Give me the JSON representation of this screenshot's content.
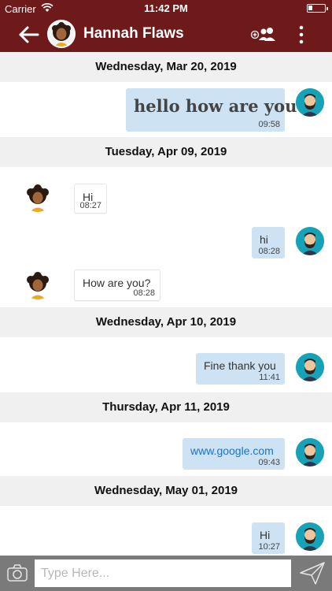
{
  "status_bar": {
    "carrier": "Carrier",
    "time": "11:42 PM",
    "icons": [
      "wifi-icon",
      "battery-icon"
    ]
  },
  "header": {
    "title": "Hannah Flaws",
    "icons": [
      "back-arrow-icon",
      "contact-avatar",
      "add-group-icon",
      "more-vertical-icon"
    ]
  },
  "messages": {
    "date_1": "Wednesday, Mar 20, 2019",
    "date_2": "Tuesday, Apr 09, 2019",
    "date_3": "Wednesday, Apr 10, 2019",
    "date_4": "Thursday, Apr 11, 2019",
    "date_5": "Wednesday, May 01, 2019",
    "m1": {
      "text": "hello how are you",
      "time": "09:58",
      "sender": "me"
    },
    "m2": {
      "text": "Hi",
      "time": "08:27",
      "sender": "contact"
    },
    "m3": {
      "text": "hi",
      "time": "08:28",
      "sender": "me"
    },
    "m4": {
      "text": "How are you?",
      "time": "08:28",
      "sender": "contact"
    },
    "m5": {
      "text": "Fine thank you",
      "time": "11:41",
      "sender": "me"
    },
    "m6": {
      "text": "www.google.com",
      "time": "09:43",
      "sender": "me"
    },
    "m7": {
      "text": "Hi",
      "time": "10:27",
      "sender": "me"
    }
  },
  "composer": {
    "placeholder": "Type Here...",
    "icons": [
      "camera-icon",
      "send-icon"
    ]
  },
  "colors": {
    "header_bg": "#6e1a1a",
    "outgoing_bubble": "#cde3f3",
    "incoming_bubble": "#ffffff",
    "date_band": "#f0f0f0",
    "link": "#1a73c9",
    "input_bar": "#7a7a7a"
  }
}
